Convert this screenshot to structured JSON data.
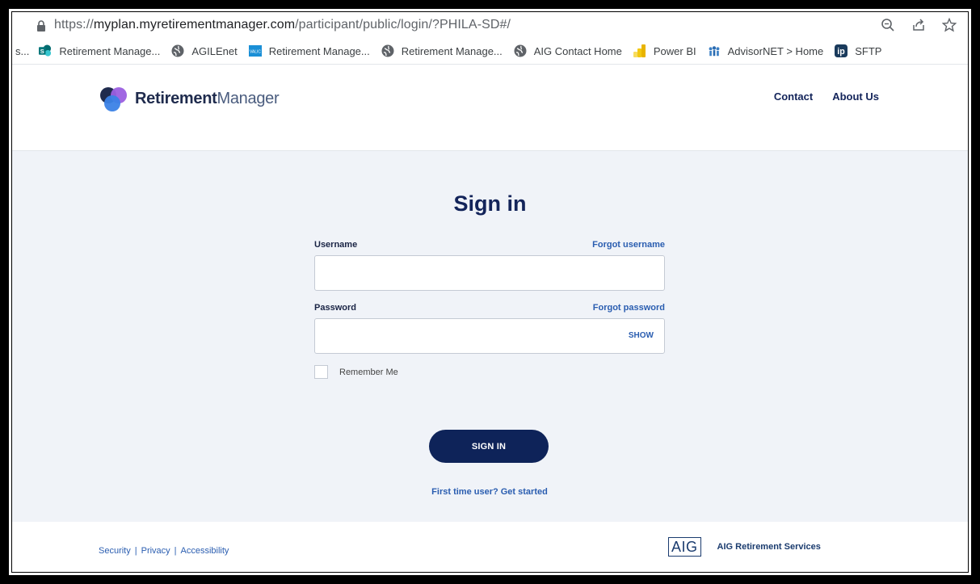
{
  "browser": {
    "url_prefix": "https://",
    "url_domain": "myplan.myretirementmanager.com",
    "url_path": "/participant/public/login/?PHILA-SD#/",
    "bookmarks": [
      {
        "label": "s...",
        "icon": "truncated"
      },
      {
        "label": "Retirement Manage...",
        "icon": "sharepoint-icon"
      },
      {
        "label": "AGILEnet",
        "icon": "globe-icon"
      },
      {
        "label": "Retirement Manage...",
        "icon": "valic-icon"
      },
      {
        "label": "Retirement Manage...",
        "icon": "globe-icon"
      },
      {
        "label": "AIG Contact Home",
        "icon": "globe-icon"
      },
      {
        "label": "Power BI",
        "icon": "powerbi-icon"
      },
      {
        "label": "AdvisorNET > Home",
        "icon": "advisornet-icon"
      },
      {
        "label": "SFTP",
        "icon": "ip-icon"
      }
    ]
  },
  "header": {
    "logo_text_1": "Retirement",
    "logo_text_2": "Manager",
    "nav": [
      "Contact",
      "About Us"
    ]
  },
  "signin": {
    "title": "Sign in",
    "username_label": "Username",
    "forgot_username": "Forgot username",
    "username_value": "",
    "password_label": "Password",
    "forgot_password": "Forgot password",
    "password_value": "",
    "show_label": "SHOW",
    "remember_label": "Remember Me",
    "button_label": "SIGN IN",
    "first_time": "First time user? Get started"
  },
  "footer": {
    "links": [
      "Security",
      "Privacy",
      "Accessibility"
    ],
    "aig_logo": "AIG",
    "aig_text": "AIG Retirement Services"
  },
  "colors": {
    "navy": "#13245a",
    "link": "#2a5db0",
    "button": "#0e2359",
    "page_bg": "#f0f3f8"
  }
}
